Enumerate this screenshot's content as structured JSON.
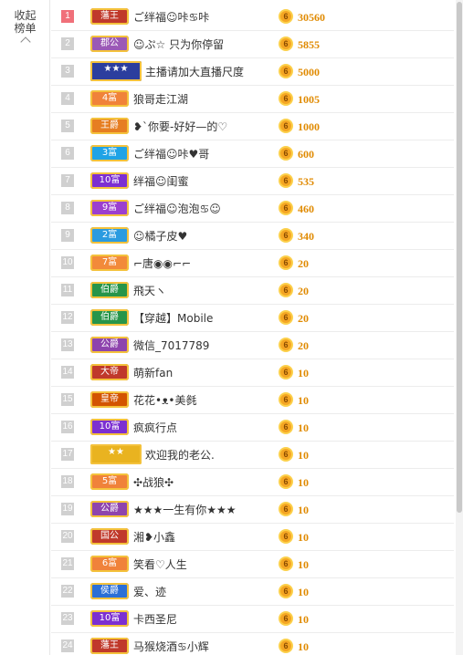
{
  "sidebar": {
    "toggle_label": "收起榜单"
  },
  "rows": [
    {
      "rank": "1",
      "badge": "藩王",
      "badge_color": "#c0392b",
      "wide": false,
      "name": "ご绊福☺咔♋咔",
      "coin": "6",
      "amount": "30560",
      "top": true
    },
    {
      "rank": "2",
      "badge": "郡公",
      "badge_color": "#9b59b6",
      "wide": false,
      "name": "☺ぷ☆ 只为你停留",
      "coin": "6",
      "amount": "5855",
      "top": false
    },
    {
      "rank": "3",
      "badge": "★★★",
      "badge_color": "#2c3e9e",
      "wide": true,
      "name": "主播请加大直播尺度",
      "coin": "6",
      "amount": "5000",
      "top": false
    },
    {
      "rank": "4",
      "badge": "4富",
      "badge_color": "#f0823a",
      "wide": false,
      "name": "狼哥走江湖",
      "coin": "6",
      "amount": "1005",
      "top": false
    },
    {
      "rank": "5",
      "badge": "王爵",
      "badge_color": "#e67e22",
      "wide": false,
      "name": "❥`你要-好好—的♡",
      "coin": "6",
      "amount": "1000",
      "top": false
    },
    {
      "rank": "6",
      "badge": "3富",
      "badge_color": "#1fa3e6",
      "wide": false,
      "name": "ご绊福☺咔♥哥",
      "coin": "6",
      "amount": "600",
      "top": false
    },
    {
      "rank": "7",
      "badge": "10富",
      "badge_color": "#7c2fd1",
      "wide": false,
      "name": "绊福☺闺蜜",
      "coin": "6",
      "amount": "535",
      "top": false
    },
    {
      "rank": "8",
      "badge": "9富",
      "badge_color": "#9b3fcf",
      "wide": false,
      "name": "ご绊福☺泡泡♋☺",
      "coin": "6",
      "amount": "460",
      "top": false
    },
    {
      "rank": "9",
      "badge": "2富",
      "badge_color": "#2b9be0",
      "wide": false,
      "name": "☺橘子皮♥",
      "coin": "6",
      "amount": "340",
      "top": false
    },
    {
      "rank": "10",
      "badge": "7富",
      "badge_color": "#f28a3a",
      "wide": false,
      "name": "⌐唐◉◉⌐⌐",
      "coin": "6",
      "amount": "20",
      "top": false
    },
    {
      "rank": "11",
      "badge": "伯爵",
      "badge_color": "#27954a",
      "wide": false,
      "name": "飛天ヽ",
      "coin": "6",
      "amount": "20",
      "top": false
    },
    {
      "rank": "12",
      "badge": "伯爵",
      "badge_color": "#27954a",
      "wide": false,
      "name": "【穿越】Mobile",
      "coin": "6",
      "amount": "20",
      "top": false
    },
    {
      "rank": "13",
      "badge": "公爵",
      "badge_color": "#8e44ad",
      "wide": false,
      "name": "微信_7017789",
      "coin": "6",
      "amount": "20",
      "top": false
    },
    {
      "rank": "14",
      "badge": "大帝",
      "badge_color": "#c0392b",
      "wide": false,
      "name": "萌新fan",
      "coin": "6",
      "amount": "10",
      "top": false
    },
    {
      "rank": "15",
      "badge": "皇帝",
      "badge_color": "#d35400",
      "wide": false,
      "name": "花花•ᴥ•美毵",
      "coin": "6",
      "amount": "10",
      "top": false
    },
    {
      "rank": "16",
      "badge": "10富",
      "badge_color": "#7c2fd1",
      "wide": false,
      "name": "疯疯行点",
      "coin": "6",
      "amount": "10",
      "top": false
    },
    {
      "rank": "17",
      "badge": "★★",
      "badge_color": "#e9b320",
      "wide": true,
      "name": "欢迎我的老公.",
      "coin": "6",
      "amount": "10",
      "top": false
    },
    {
      "rank": "18",
      "badge": "5富",
      "badge_color": "#f0823a",
      "wide": false,
      "name": "✣战狼✣",
      "coin": "6",
      "amount": "10",
      "top": false
    },
    {
      "rank": "19",
      "badge": "公爵",
      "badge_color": "#8e44ad",
      "wide": false,
      "name": "★★★一生有你★★★",
      "coin": "6",
      "amount": "10",
      "top": false
    },
    {
      "rank": "20",
      "badge": "国公",
      "badge_color": "#c0392b",
      "wide": false,
      "name": "湘❥小鑫",
      "coin": "6",
      "amount": "10",
      "top": false
    },
    {
      "rank": "21",
      "badge": "6富",
      "badge_color": "#f0823a",
      "wide": false,
      "name": "笑看♡人生",
      "coin": "6",
      "amount": "10",
      "top": false
    },
    {
      "rank": "22",
      "badge": "侯爵",
      "badge_color": "#2b6fd6",
      "wide": false,
      "name": "爱、迹",
      "coin": "6",
      "amount": "10",
      "top": false
    },
    {
      "rank": "23",
      "badge": "10富",
      "badge_color": "#7c2fd1",
      "wide": false,
      "name": "卡西圣尼",
      "coin": "6",
      "amount": "10",
      "top": false
    },
    {
      "rank": "24",
      "badge": "藩王",
      "badge_color": "#c0392b",
      "wide": false,
      "name": "马猴烧酒♋小辉",
      "coin": "6",
      "amount": "10",
      "top": false
    }
  ]
}
